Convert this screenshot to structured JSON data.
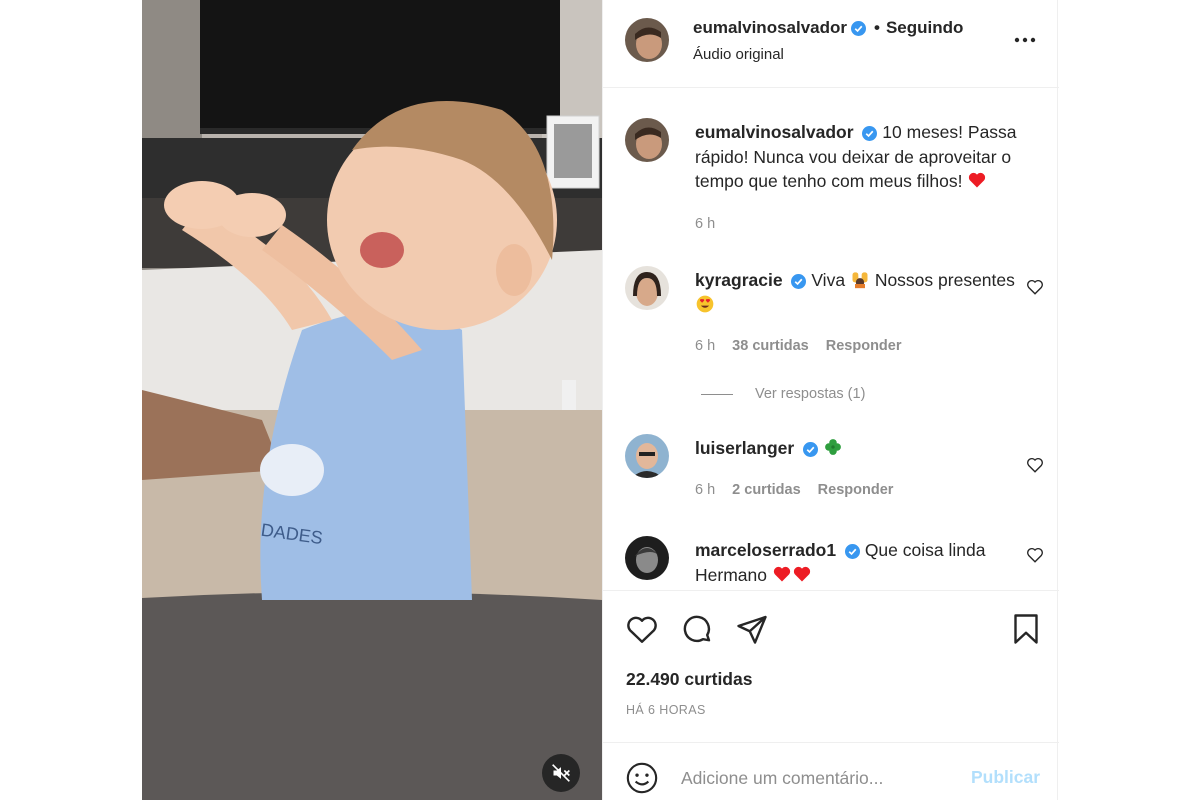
{
  "post": {
    "author": "eumalvinosalvador",
    "separator": "•",
    "follow_status": "Seguindo",
    "audio": "Áudio original",
    "caption": "10 meses! Passa rápido! Nunca vou deixar de aproveitar o tempo que tenho com meus filhos!",
    "caption_time": "6 h",
    "likes": "22.490 curtidas",
    "posted": "HÁ 6 HORAS"
  },
  "comments": [
    {
      "user": "kyragracie",
      "text_before": "Viva",
      "text_after": "Nossos presentes",
      "time": "6 h",
      "likes": "38 curtidas",
      "reply": "Responder",
      "view_replies": "Ver respostas (1)"
    },
    {
      "user": "luiserlanger",
      "time": "6 h",
      "likes": "2 curtidas",
      "reply": "Responder"
    },
    {
      "user": "marceloserrado1",
      "text": "Que coisa linda Hermano"
    }
  ],
  "comment_box": {
    "placeholder": "Adicione um comentário...",
    "publish": "Publicar"
  },
  "icons": [
    "verified-icon",
    "more-icon",
    "heart-icon",
    "comment-icon",
    "share-icon",
    "bookmark-icon",
    "emoji-icon",
    "mute-icon",
    "heart-emoji",
    "clover-emoji",
    "heart-eyes-emoji",
    "raising-hands-emoji"
  ],
  "colors": {
    "verified": "#3897f0",
    "publish_disabled": "#b2dffc",
    "meta": "#8e8e8e",
    "heart_red": "#ed1c24"
  }
}
